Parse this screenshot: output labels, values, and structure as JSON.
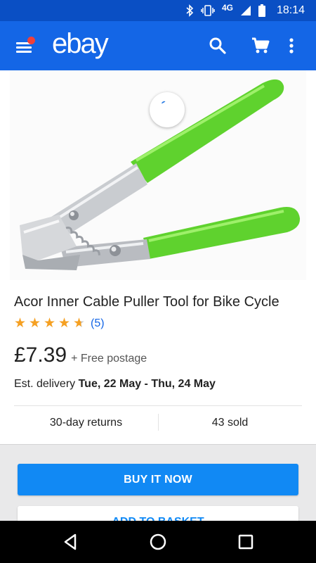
{
  "status_bar": {
    "network": "4G",
    "time": "18:14"
  },
  "app_bar": {
    "logo": "ebay"
  },
  "product": {
    "title": "Acor Inner Cable Puller Tool for Bike Cycle",
    "rating": 4.5,
    "rating_max": 5,
    "review_count": "(5)",
    "price": "£7.39",
    "postage": "+ Free postage",
    "delivery_prefix": "Est. delivery ",
    "delivery_dates": "Tue, 22 May - Thu, 24 May",
    "returns": "30-day returns",
    "sold": "43 sold"
  },
  "actions": {
    "buy_now": "BUY IT NOW",
    "add_to_basket": "ADD TO BASKET"
  },
  "colors": {
    "status_bar": "#0a4fc4",
    "app_bar": "#1466e6",
    "primary_button": "#1189f4",
    "star": "#f5a022",
    "handle_green": "#5fd22e"
  }
}
